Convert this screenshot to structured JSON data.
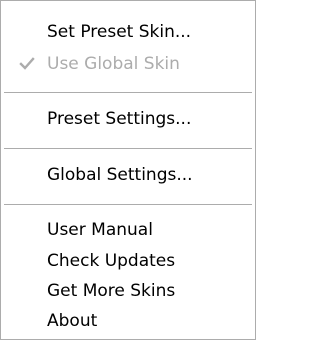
{
  "menu": {
    "items": [
      {
        "label": "Set Preset Skin...",
        "enabled": true,
        "checked": false
      },
      {
        "label": "Use Global Skin",
        "enabled": false,
        "checked": true
      },
      {
        "label": "Preset Settings...",
        "enabled": true,
        "checked": false
      },
      {
        "label": "Global Settings...",
        "enabled": true,
        "checked": false
      },
      {
        "label": "User Manual",
        "enabled": true,
        "checked": false
      },
      {
        "label": "Check Updates",
        "enabled": true,
        "checked": false
      },
      {
        "label": "Get More Skins",
        "enabled": true,
        "checked": false
      },
      {
        "label": "About",
        "enabled": true,
        "checked": false
      }
    ],
    "colors": {
      "border": "#acacac",
      "separator": "#acacac",
      "disabled_text": "#acacac",
      "checkmark": "#acacac",
      "text": "#000000",
      "background": "#ffffff"
    }
  }
}
